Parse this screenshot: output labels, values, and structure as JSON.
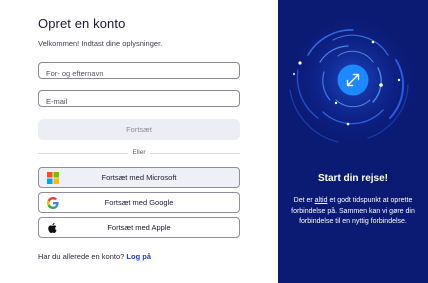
{
  "form": {
    "title": "Opret en konto",
    "subtitle": "Velkommen! Indtast dine oplysninger.",
    "name_placeholder": "For- og efternavn",
    "name_value": "",
    "email_placeholder": "E-mail",
    "email_value": "",
    "continue_label": "Fortsæt",
    "divider_label": "Eller",
    "microsoft_label": "Fortsæt med Microsoft",
    "google_label": "Fortsæt med Google",
    "apple_label": "Fortsæt med Apple",
    "login_prompt": "Har du allerede en konto?",
    "login_link": "Log på"
  },
  "hero": {
    "title": "Start din rejse!",
    "text_before": "Det er ",
    "text_underlined": "altid",
    "text_after": " et godt tidspunkt at oprette forbindelse på. Sammen kan vi gøre din forbindelse til en nyttig forbindelse.",
    "icon": "expand-arrows-icon"
  },
  "colors": {
    "brand_dark": "#0b1a73",
    "accent_blue": "#1e88ff",
    "link": "#1f3fb7"
  }
}
